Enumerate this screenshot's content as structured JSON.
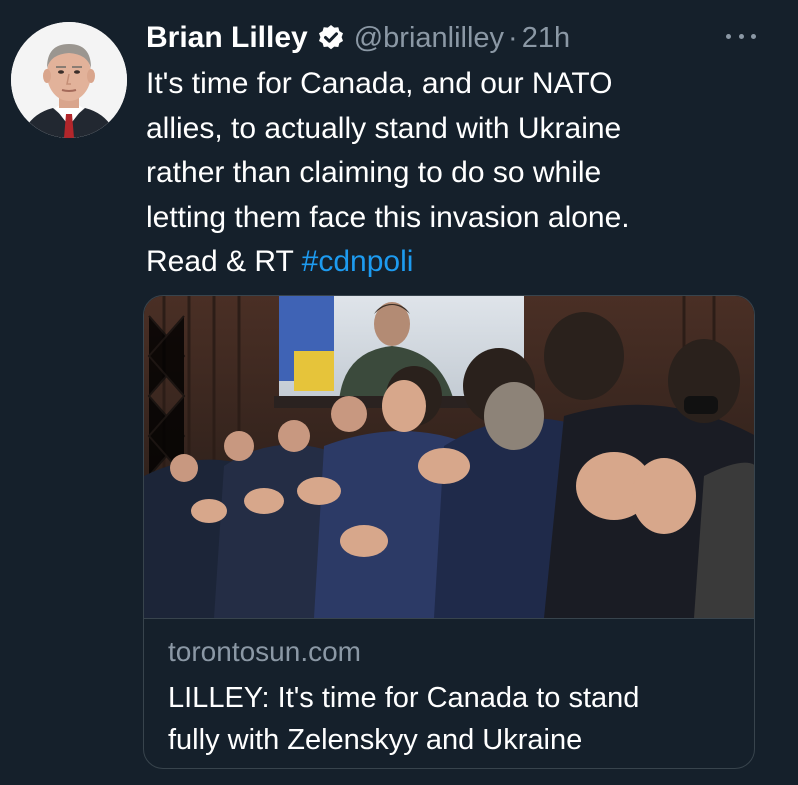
{
  "tweet": {
    "author_name": "Brian Lilley",
    "handle": "@brianlilley",
    "separator": "·",
    "time": "21h",
    "text_lines": [
      "It's time for Canada, and our NATO",
      "allies, to actually stand with Ukraine",
      "rather than claiming to do so while",
      "letting them face this invasion alone."
    ],
    "last_line_prefix": "Read & RT ",
    "hashtag": "#cdnpoli",
    "icons": {
      "verified": "verified-badge-icon",
      "more": "more-options-icon"
    }
  },
  "card": {
    "domain": "torontosun.com",
    "title_lines": [
      "LILLEY: It's time for Canada to stand",
      "fully with Zelenskyy and Ukraine"
    ]
  },
  "colors": {
    "background": "#15202b",
    "secondary_text": "#8b98a5",
    "link": "#1d9bf0",
    "border": "#38444d"
  }
}
